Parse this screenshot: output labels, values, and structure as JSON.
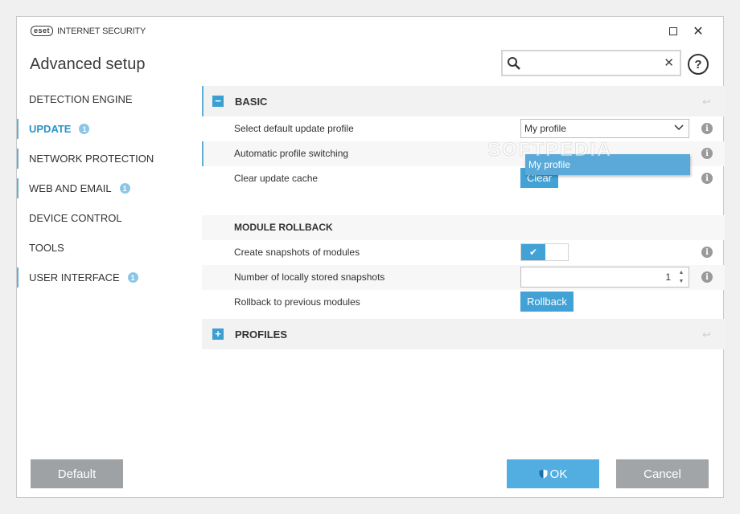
{
  "window": {
    "brand_mark": "eset",
    "product_name": "INTERNET SECURITY",
    "page_title": "Advanced setup"
  },
  "search": {
    "placeholder": "",
    "value": ""
  },
  "sidebar": {
    "items": [
      {
        "label": "DETECTION ENGINE",
        "badge": ""
      },
      {
        "label": "UPDATE",
        "badge": "1"
      },
      {
        "label": "NETWORK PROTECTION",
        "badge": ""
      },
      {
        "label": "WEB AND EMAIL",
        "badge": "1"
      },
      {
        "label": "DEVICE CONTROL",
        "badge": ""
      },
      {
        "label": "TOOLS",
        "badge": ""
      },
      {
        "label": "USER INTERFACE",
        "badge": "1"
      }
    ]
  },
  "basic": {
    "title": "BASIC",
    "rows": {
      "profile_label": "Select default update profile",
      "profile_value": "My profile",
      "profile_option": "My profile",
      "switching_label": "Automatic profile switching",
      "cache_label": "Clear update cache",
      "cache_button": "Clear"
    }
  },
  "rollback": {
    "title": "MODULE ROLLBACK",
    "snapshots_label": "Create snapshots of modules",
    "snapshots_enabled": true,
    "count_label": "Number of locally stored snapshots",
    "count_value": "1",
    "rollback_label": "Rollback to previous modules",
    "rollback_button": "Rollback"
  },
  "profiles": {
    "title": "PROFILES"
  },
  "footer": {
    "default_label": "Default",
    "ok_label": "OK",
    "cancel_label": "Cancel"
  },
  "watermark": "SOFTPEDIA",
  "colors": {
    "accent": "#42a2d6",
    "marker": "#5fb0d8",
    "neutral_button": "#9ea2a5"
  }
}
